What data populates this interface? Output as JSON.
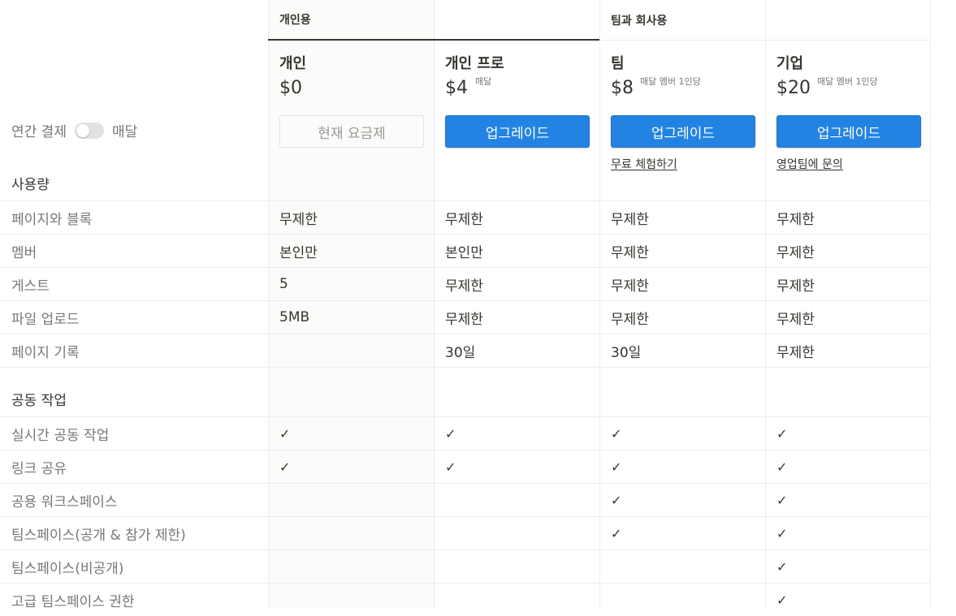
{
  "groups": {
    "personal": "개인용",
    "team": "팀과 회사용"
  },
  "billing": {
    "annual_label": "연간 결제",
    "monthly_label": "매달"
  },
  "plans": [
    {
      "name": "개인",
      "price": "$0",
      "note": "",
      "button": "현재 요금제",
      "link": ""
    },
    {
      "name": "개인 프로",
      "price": "$4",
      "note": "매달",
      "button": "업그레이드",
      "link": ""
    },
    {
      "name": "팀",
      "price": "$8",
      "note": "매달 멤버 1인당",
      "button": "업그레이드",
      "link": "무료 체험하기"
    },
    {
      "name": "기업",
      "price": "$20",
      "note": "매달 멤버 1인당",
      "button": "업그레이드",
      "link": "영업팀에 문의"
    }
  ],
  "sections": {
    "usage": {
      "title": "사용량",
      "rows": [
        {
          "label": "페이지와 블록",
          "values": [
            "무제한",
            "무제한",
            "무제한",
            "무제한"
          ]
        },
        {
          "label": "멤버",
          "values": [
            "본인만",
            "본인만",
            "무제한",
            "무제한"
          ]
        },
        {
          "label": "게스트",
          "values": [
            "5",
            "무제한",
            "무제한",
            "무제한"
          ]
        },
        {
          "label": "파일 업로드",
          "values": [
            "5MB",
            "무제한",
            "무제한",
            "무제한"
          ]
        },
        {
          "label": "페이지 기록",
          "values": [
            "",
            "30일",
            "30일",
            "무제한"
          ]
        }
      ]
    },
    "collab": {
      "title": "공동 작업",
      "rows": [
        {
          "label": "실시간 공동 작업",
          "values": [
            "✓",
            "✓",
            "✓",
            "✓"
          ]
        },
        {
          "label": "링크 공유",
          "values": [
            "✓",
            "✓",
            "✓",
            "✓"
          ]
        },
        {
          "label": "공용 워크스페이스",
          "values": [
            "",
            "",
            "✓",
            "✓"
          ]
        },
        {
          "label": "팀스페이스(공개 & 참가 제한)",
          "values": [
            "",
            "",
            "✓",
            "✓"
          ]
        },
        {
          "label": "팀스페이스(비공개)",
          "values": [
            "",
            "",
            "",
            "✓"
          ]
        },
        {
          "label": "고급 팀스페이스 권한",
          "values": [
            "",
            "",
            "",
            "✓"
          ]
        }
      ]
    }
  }
}
